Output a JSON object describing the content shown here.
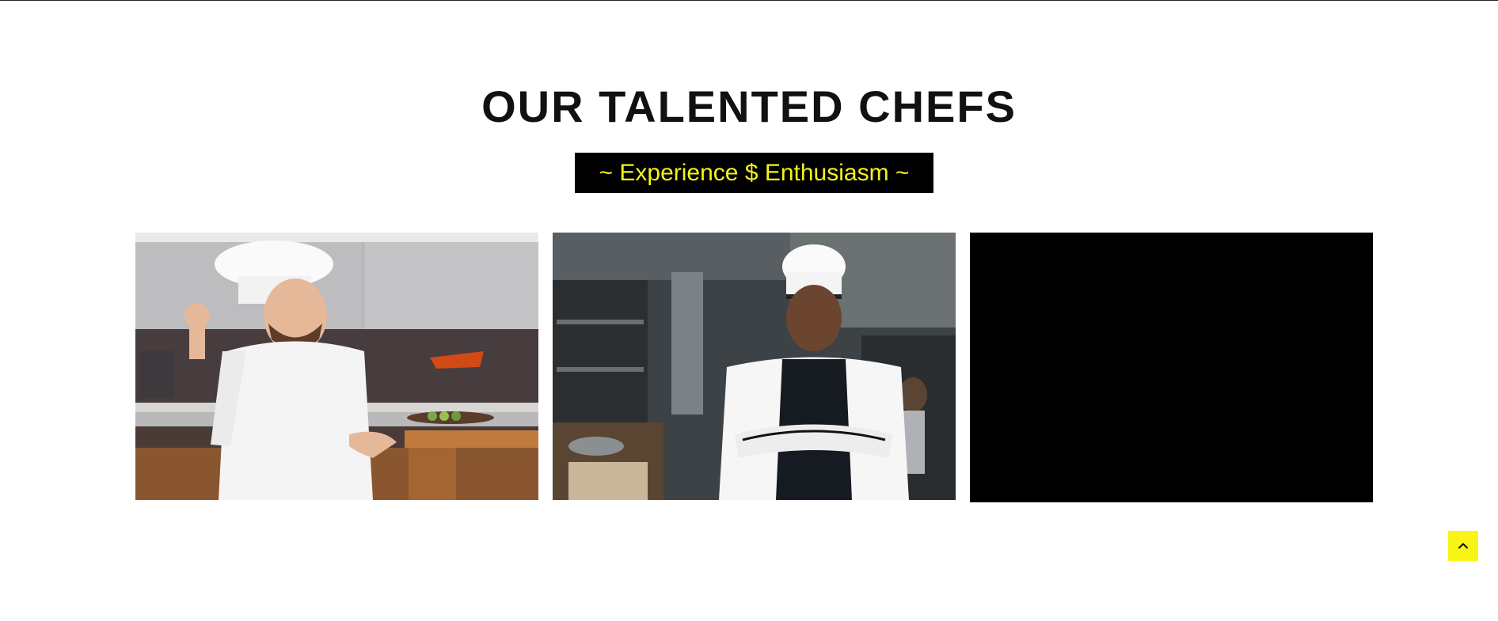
{
  "section": {
    "title": "OUR TALENTED CHEFS",
    "tagline": "~ Experience $ Enthusiasm ~"
  },
  "chefs": [
    {
      "image": "chef-okay-gesture-photo"
    },
    {
      "image": "chef-arms-crossed-kitchen-photo"
    },
    {
      "image": "blank-black-image"
    }
  ],
  "scroll_top": {
    "icon": "chevron-up-icon"
  },
  "colors": {
    "tagline_bg": "#000000",
    "tagline_text": "#f4f21a",
    "scroll_button_bg": "#f8f516",
    "title_text": "#111111"
  }
}
